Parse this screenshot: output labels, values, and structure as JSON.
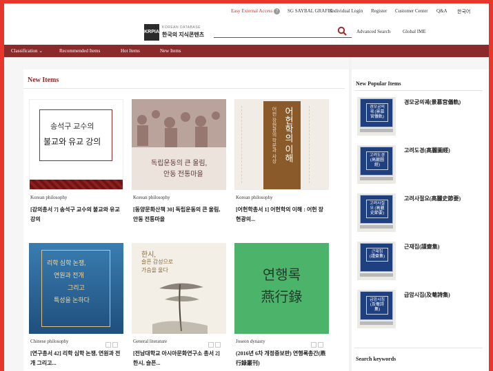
{
  "topbar": {
    "easy_access": "Easy External Access",
    "user": "SG SAYBAL GRAFIK",
    "individual_login": "Individual Login",
    "register": "Register",
    "customer_center": "Customer Center",
    "qa": "Q&A",
    "language": "한국어"
  },
  "header": {
    "logo_mark": "KRPIA",
    "logo_sub": "KOREAN DATABASE",
    "logo_name": "한국의 지식콘텐츠",
    "search_placeholder": "",
    "advanced_search": "Advanced Search",
    "global_ime": "Global IME"
  },
  "nav": {
    "classification": "Classification",
    "recommended": "Recommended Items",
    "hot": "Hot Items",
    "new": "New Items"
  },
  "main": {
    "section_title": "New Items",
    "cards": [
      {
        "category": "Korean philosophy",
        "title": "[강의총서 7] 송석구 교수의 불교와 유교 강의",
        "cover_text": [
          "송석구 교수의",
          "불교와 유교 강의"
        ]
      },
      {
        "category": "Korean philosophy",
        "title": "[동양문화산책 30] 독립운동의 큰 울림, 안동 전통마을",
        "cover_text": [
          "독립운동의 큰 울림,",
          "안동 전통마을"
        ]
      },
      {
        "category": "Korean philosophy",
        "title": "[어헌학총서 1] 어헌학의 이해 : 어헌 장현광의...",
        "cover_text": [
          "어헌학의 이해",
          "어헌 장현광의 학문과 사상"
        ]
      },
      {
        "category": "Chinese philosophy",
        "title": "[연구총서 42] 리학 심학 논쟁, 연원과 전개 그리고...",
        "cover_text": [
          "리학 심학 논쟁,",
          "연원과 전개",
          "그리고",
          "특성을 논하다"
        ]
      },
      {
        "category": "General literature",
        "title": "[전남대학교 아시아문화연구소 총서 2] 한시, 슬픈...",
        "cover_text": [
          "한시,",
          "슬픈 감성으로",
          "가슴을 울다"
        ]
      },
      {
        "category": "Joseon dynasty",
        "title": "(2016년 6차 개정증보판) 연행록총간(燕行錄叢刊)",
        "cover_text": [
          "연행록",
          "燕行錄"
        ]
      }
    ]
  },
  "sidebar": {
    "title": "New Popular Items",
    "items": [
      {
        "name": "경모궁의궤(景慕宮儀軌)",
        "cover": "경모궁의궤 (景慕宮儀軌)"
      },
      {
        "name": "고려도경(高麗圖經)",
        "cover": "고려도경 (高麗圖經)"
      },
      {
        "name": "고려사절요(高麗史節要)",
        "cover": "고려사절요 (高麗史節要)"
      },
      {
        "name": "근재집(謹齋集)",
        "cover": "근재집 (謹齋集)"
      },
      {
        "name": "급암시집(及菴詩集)",
        "cover": "급암시집 (及菴詩集)"
      }
    ],
    "search_keywords": "Search keywords"
  },
  "colors": {
    "nav_bg": "#8b2a2a",
    "accent": "#8b2a2a",
    "frame": "#e8372a",
    "book_blue": "#1e3f80",
    "green_cover": "#4cb36a"
  }
}
